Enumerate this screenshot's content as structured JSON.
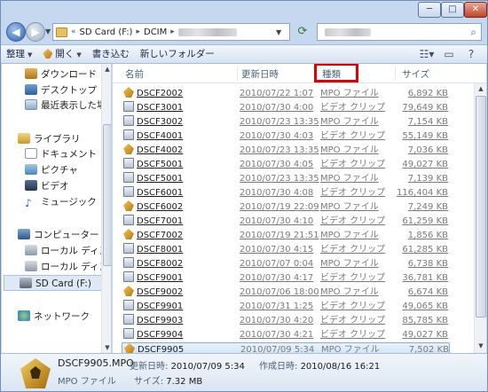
{
  "caption": {
    "min": "─",
    "max": "□",
    "close": "✕"
  },
  "nav": {
    "back": "◀",
    "forward": "▶",
    "address": {
      "prefix": "«",
      "segments": [
        "SD Card (F:)",
        "DCIM"
      ]
    },
    "search_placeholder": "検索"
  },
  "toolbar": {
    "organize": "整理",
    "open": "開く",
    "burn": "書き込む",
    "new_folder": "新しいフォルダー"
  },
  "nav_pane": {
    "items": [
      {
        "label": "ダウンロード",
        "icon": "download-folder-icon"
      },
      {
        "label": "デスクトップ",
        "icon": "desktop-icon"
      },
      {
        "label": "最近表示した場所",
        "icon": "recent-places-icon"
      },
      {
        "label": "ライブラリ",
        "icon": "library-icon"
      },
      {
        "label": "ドキュメント",
        "icon": "documents-icon"
      },
      {
        "label": "ピクチャ",
        "icon": "pictures-icon"
      },
      {
        "label": "ビデオ",
        "icon": "videos-icon"
      },
      {
        "label": "ミュージック",
        "icon": "music-icon"
      },
      {
        "label": "コンピューター",
        "icon": "computer-icon"
      },
      {
        "label": "ローカル ディスク",
        "icon": "local-disk-icon"
      },
      {
        "label": "ローカル ディスク",
        "icon": "local-disk-icon"
      },
      {
        "label": "SD Card (F:)",
        "icon": "sd-card-icon"
      },
      {
        "label": "ネットワーク",
        "icon": "network-icon"
      }
    ]
  },
  "columns": {
    "name": "名前",
    "date": "更新日時",
    "type": "種類",
    "size": "サイズ"
  },
  "files": [
    {
      "name": "DSCF2002",
      "date": "2010/07/22 1:07",
      "type": "MPO ファイル",
      "size": "6,892 KB",
      "kind": "mpo"
    },
    {
      "name": "DSCF3001",
      "date": "2010/07/30 4:00",
      "type": "ビデオ クリップ",
      "size": "79,649 KB",
      "kind": "mov"
    },
    {
      "name": "DSCF3002",
      "date": "2010/07/23 13:35",
      "type": "MPO ファイル",
      "size": "7,154 KB",
      "kind": "mov"
    },
    {
      "name": "DSCF4001",
      "date": "2010/07/30 4:03",
      "type": "ビデオ クリップ",
      "size": "55,149 KB",
      "kind": "mov"
    },
    {
      "name": "DSCF4002",
      "date": "2010/07/23 13:35",
      "type": "MPO ファイル",
      "size": "7,036 KB",
      "kind": "mpo"
    },
    {
      "name": "DSCF5001",
      "date": "2010/07/30 4:05",
      "type": "ビデオ クリップ",
      "size": "49,027 KB",
      "kind": "mov"
    },
    {
      "name": "DSCF5001",
      "date": "2010/07/23 13:35",
      "type": "MPO ファイル",
      "size": "7,139 KB",
      "kind": "mov"
    },
    {
      "name": "DSCF6001",
      "date": "2010/07/30 4:08",
      "type": "ビデオ クリップ",
      "size": "116,404 KB",
      "kind": "mov"
    },
    {
      "name": "DSCF6002",
      "date": "2010/07/19 22:09",
      "type": "MPO ファイル",
      "size": "7,249 KB",
      "kind": "mpo"
    },
    {
      "name": "DSCF7001",
      "date": "2010/07/30 4:10",
      "type": "ビデオ クリップ",
      "size": "61,259 KB",
      "kind": "mov"
    },
    {
      "name": "DSCF7002",
      "date": "2010/07/19 21:51",
      "type": "MPO ファイル",
      "size": "1,856 KB",
      "kind": "mpo"
    },
    {
      "name": "DSCF8001",
      "date": "2010/07/30 4:15",
      "type": "ビデオ クリップ",
      "size": "61,285 KB",
      "kind": "mov"
    },
    {
      "name": "DSCF8002",
      "date": "2010/07/07 0:04",
      "type": "MPO ファイル",
      "size": "6,738 KB",
      "kind": "mov"
    },
    {
      "name": "DSCF9001",
      "date": "2010/07/30 4:17",
      "type": "ビデオ クリップ",
      "size": "36,781 KB",
      "kind": "mov"
    },
    {
      "name": "DSCF9002",
      "date": "2010/07/06 18:00",
      "type": "MPO ファイル",
      "size": "6,674 KB",
      "kind": "mpo"
    },
    {
      "name": "DSCF9901",
      "date": "2010/07/31 1:25",
      "type": "ビデオ クリップ",
      "size": "49,065 KB",
      "kind": "mov"
    },
    {
      "name": "DSCF9903",
      "date": "2010/07/30 4:20",
      "type": "ビデオ クリップ",
      "size": "85,785 KB",
      "kind": "mov"
    },
    {
      "name": "DSCF9904",
      "date": "2010/07/30 4:21",
      "type": "ビデオ クリップ",
      "size": "49,027 KB",
      "kind": "mov"
    },
    {
      "name": "DSCF9905",
      "date": "2010/07/09 5:34",
      "type": "MPO ファイル",
      "size": "7,502 KB",
      "kind": "mpo",
      "selected": true
    }
  ],
  "details": {
    "filename": "DSCF9905.MPO",
    "type": "MPO ファイル",
    "modified_label": "更新日時:",
    "modified_value": "2010/07/09 5:34",
    "created_label": "作成日時:",
    "created_value": "2010/08/16 16:21",
    "size_label": "サイズ:",
    "size_value": "7.32 MB"
  }
}
